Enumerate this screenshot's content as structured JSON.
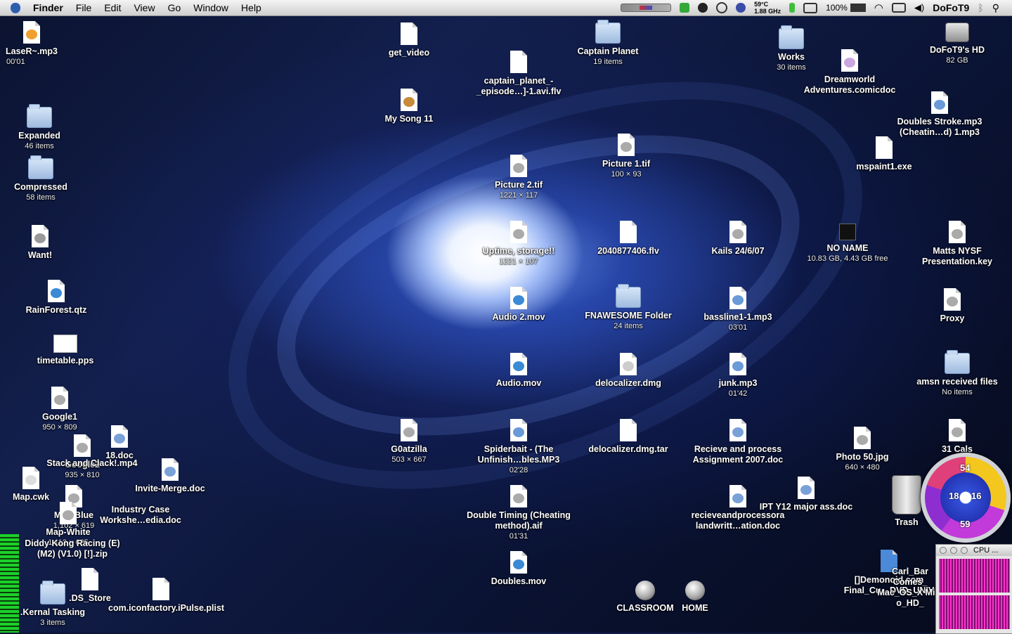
{
  "menubar": {
    "app": "Finder",
    "items": [
      "File",
      "Edit",
      "View",
      "Go",
      "Window",
      "Help"
    ],
    "temperature": "59°C",
    "cpu_speed": "1.88 GHz",
    "battery": "100%",
    "user": "DoFoT9"
  },
  "icons": {
    "laser": {
      "label": "LaseR~.mp3",
      "sub": "00'01"
    },
    "expanded": {
      "label": "Expanded",
      "sub": "46 items"
    },
    "compressed": {
      "label": "Compressed",
      "sub": "58 items"
    },
    "want": {
      "label": "Want!"
    },
    "rainforest": {
      "label": "RainForest.qtz"
    },
    "timetable": {
      "label": "timetable.pps"
    },
    "google1": {
      "label": "Google1",
      "sub": "950 × 809"
    },
    "google2": {
      "label": "Google2",
      "sub": "935 × 810"
    },
    "doc18": {
      "label": "18.doc"
    },
    "stackclack": {
      "label": "Stack and Clack!.mp4"
    },
    "mapcwk": {
      "label": "Map.cwk"
    },
    "mapblue": {
      "label": "Map-Blue",
      "sub": "1,102 × 619"
    },
    "mapwhite": {
      "label": "Map-White",
      "sub": "1,112 × 625"
    },
    "invitemerge": {
      "label": "Invite-Merge.doc"
    },
    "industrycase": {
      "label": "Industry Case Workshe…edia.doc"
    },
    "diddy": {
      "label": "Diddy Kong Racing (E) (M2) (V1.0) [!].zip"
    },
    "dsstore": {
      "label": ".DS_Store"
    },
    "kernal": {
      "label": ".Kernal Tasking",
      "sub": "3 items"
    },
    "plist": {
      "label": "com.iconfactory.iPulse.plist"
    },
    "getvideo": {
      "label": "get_video"
    },
    "mysong": {
      "label": "My Song 11"
    },
    "captainflv": {
      "label": "captain_planet_-_episode…]-1.avi.flv"
    },
    "captainplanet": {
      "label": "Captain Planet",
      "sub": "19 items"
    },
    "picture2": {
      "label": "Picture 2.tif",
      "sub": "1221 × 117"
    },
    "picture1": {
      "label": "Picture 1.tif",
      "sub": "100 × 93"
    },
    "uptime": {
      "label": "Uptime, storage!!",
      "sub": "1221 × 107"
    },
    "flv2040": {
      "label": "2040877406.flv"
    },
    "kails": {
      "label": "Kails 24/6/07"
    },
    "audio2": {
      "label": "Audio 2.mov"
    },
    "fnawesome": {
      "label": "FNAWESOME Folder",
      "sub": "24 items"
    },
    "bassline": {
      "label": "bassline1-1.mp3",
      "sub": "03'01"
    },
    "audiomov": {
      "label": "Audio.mov"
    },
    "delocalizer": {
      "label": "delocalizer.dmg"
    },
    "junk": {
      "label": "junk.mp3",
      "sub": "01'42"
    },
    "goatzilla": {
      "label": "G0atzilla",
      "sub": "503 × 667"
    },
    "spiderbait": {
      "label": "Spiderbait - (The Unfinish…bles.MP3",
      "sub": "02'28"
    },
    "delocalizertar": {
      "label": "delocalizer.dmg.tar"
    },
    "recieve": {
      "label": "Recieve and process Assignment 2007.doc"
    },
    "doubletiming": {
      "label": "Double Timing (Cheating method).aif",
      "sub": "01'31"
    },
    "doublesmov": {
      "label": "Doubles.mov"
    },
    "recieveand": {
      "label": "recieveandprocessora landwritt…ation.doc"
    },
    "ipt": {
      "label": "IPT Y12 major ass.doc"
    },
    "classroom": {
      "label": "CLASSROOM"
    },
    "home": {
      "label": "HOME"
    },
    "works": {
      "label": "Works",
      "sub": "30 items"
    },
    "dreamworld": {
      "label": "Dreamworld Adventures.comicdoc"
    },
    "hd": {
      "label": "DoFoT9's HD",
      "sub": "82 GB"
    },
    "doublestroke": {
      "label": "Doubles Stroke.mp3 (Cheatin…d) 1.mp3"
    },
    "mspaint": {
      "label": "mspaint1.exe"
    },
    "noname": {
      "label": "NO NAME",
      "sub": "10.83 GB, 4.43 GB free"
    },
    "matts": {
      "label": "Matts NYSF Presentation.key"
    },
    "proxy": {
      "label": "Proxy"
    },
    "amsn": {
      "label": "amsn received files",
      "sub": "No items"
    },
    "photo50": {
      "label": "Photo 50.jpg",
      "sub": "640 × 480"
    },
    "cals": {
      "label": "31 Cals"
    },
    "trash": {
      "label": "Trash"
    },
    "demonoid": {
      "label": "[]Demonoid.com Final_Cu…DVD_UNIV"
    },
    "carlbar": {
      "label": "Carl_Bar Comes_ Mac_OS_X Mini o_HD_"
    }
  },
  "gauge": {
    "top": "54",
    "left": "18",
    "right": "16",
    "bottom": "59"
  },
  "cpu_window": {
    "title": "CPU ..."
  }
}
